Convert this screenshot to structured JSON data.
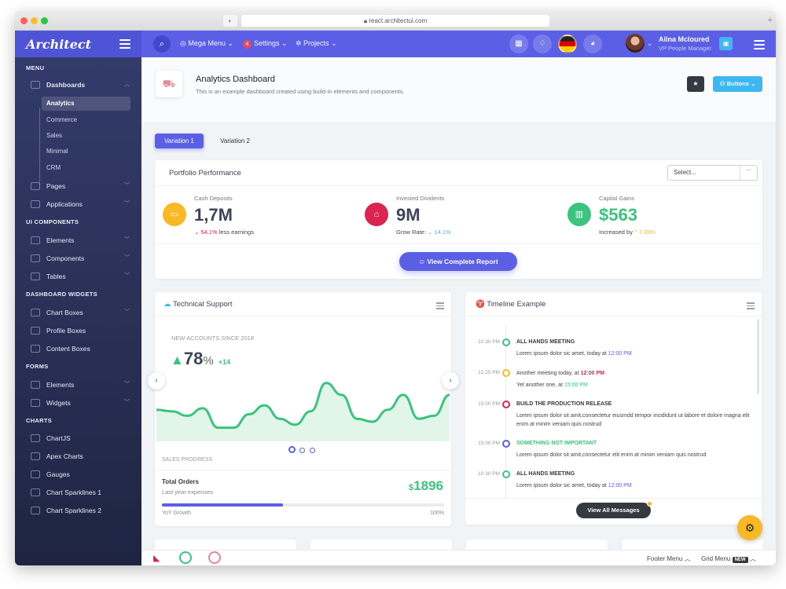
{
  "browser": {
    "url": "react.architectui.com"
  },
  "app": {
    "logo_text": "Architect"
  },
  "topbar": {
    "mega_menu": "Mega Menu",
    "settings": "Settings",
    "settings_badge": "4",
    "projects": "Projects",
    "user_name": "Alina Mcloured",
    "user_role": "VP People Manager"
  },
  "sidebar": {
    "menu_header": "MENU",
    "dashboards": "Dashboards",
    "dashboard_items": [
      "Analytics",
      "Commerce",
      "Sales",
      "Minimal",
      "CRM"
    ],
    "pages": "Pages",
    "applications": "Applications",
    "ui_components_header": "UI COMPONENTS",
    "elements": "Elements",
    "components": "Components",
    "tables": "Tables",
    "widgets_header": "DASHBOARD WIDGETS",
    "chart_boxes": "Chart Boxes",
    "profile_boxes": "Profile Boxes",
    "content_boxes": "Content Boxes",
    "forms_header": "FORMS",
    "forms_elements": "Elements",
    "forms_widgets": "Widgets",
    "charts_header": "CHARTS",
    "chartjs": "ChartJS",
    "apex_charts": "Apex Charts",
    "gauges": "Gauges",
    "sparklines1": "Chart Sparklines 1",
    "sparklines2": "Chart Sparklines 2"
  },
  "page": {
    "title": "Analytics Dashboard",
    "subtitle": "This is an example dashboard created using build-in elements and components.",
    "buttons_label": "Buttons",
    "tab1": "Variation 1",
    "tab2": "Variation 2"
  },
  "portfolio": {
    "title": "Portfolio Performance",
    "select_placeholder": "Select...",
    "kpis": [
      {
        "label": "Cash Deposits",
        "value": "1,7M",
        "change": "54.1%",
        "note": "less earnings",
        "color": "#f7b924"
      },
      {
        "label": "Invested Dividents",
        "value": "9M",
        "note_prefix": "Grow Rate:",
        "change": "14.1%",
        "color": "#d92550"
      },
      {
        "label": "Capital Gains",
        "value": "$563",
        "note_prefix": "Increased by",
        "change": "7.35%",
        "color": "#3ac47d"
      }
    ],
    "report_button": "View Complete Report"
  },
  "support": {
    "title": "Technical Support",
    "accounts_label": "NEW ACCOUNTS SINCE 2018",
    "percent_value": "78",
    "percent_sign": "%",
    "delta": "+14",
    "sales_progress": "SALES PROGRESS",
    "total_orders": "Total Orders",
    "last_year": "Last year expenses",
    "amount_currency": "$",
    "amount": "1896",
    "yoy": "YoY Growth",
    "yoy_pct": "100%",
    "progress": 0.43
  },
  "chart_data": {
    "type": "area",
    "values": [
      48,
      47,
      44,
      49,
      36,
      36,
      45,
      51,
      42,
      38,
      47,
      66,
      58,
      42,
      40,
      48,
      58,
      42,
      44,
      58
    ],
    "color": "#3ac47d",
    "fill": "#e1f5e8"
  },
  "timeline": {
    "title": "Timeline Example",
    "items": [
      {
        "time": "10:30 PM",
        "color": "#3ac47d",
        "heading": "ALL HANDS MEETING",
        "text": "Lorem ipsum dolor sic amet, today at ",
        "link": "12:00 PM"
      },
      {
        "time": "12:25 PM",
        "color": "#f7b924",
        "line1": "Another meeting today, at ",
        "line1_time": "12:00 PM",
        "line2": "Yet another one, at ",
        "line2_time": "15:00 PM"
      },
      {
        "time": "15:00 PM",
        "color": "#d92550",
        "heading": "BUILD THE PRODUCTION RELEASE",
        "text": "Lorem ipsum dolor sit amit,consectetur eiusmdd tempor incididunt ut labore et dolore magna elit enim at minim veniam quis nostrud"
      },
      {
        "time": "15:00 PM",
        "color": "#5b5fe6",
        "heading": "SOMETHING NOT IMPORTANT",
        "text": "Lorem ipsum dolor sit amit,consectetur elit enim at minim veniam quis nostrud"
      },
      {
        "time": "10:30 PM",
        "color": "#3ac47d",
        "heading": "ALL HANDS MEETING",
        "text": "Lorem ipsum dolor sic amet, today at ",
        "link": "12:00 PM"
      }
    ],
    "view_all": "View All Messages"
  },
  "footer": {
    "footer_menu": "Footer Menu",
    "grid_menu": "Grid Menu",
    "new_badge": "NEW"
  }
}
